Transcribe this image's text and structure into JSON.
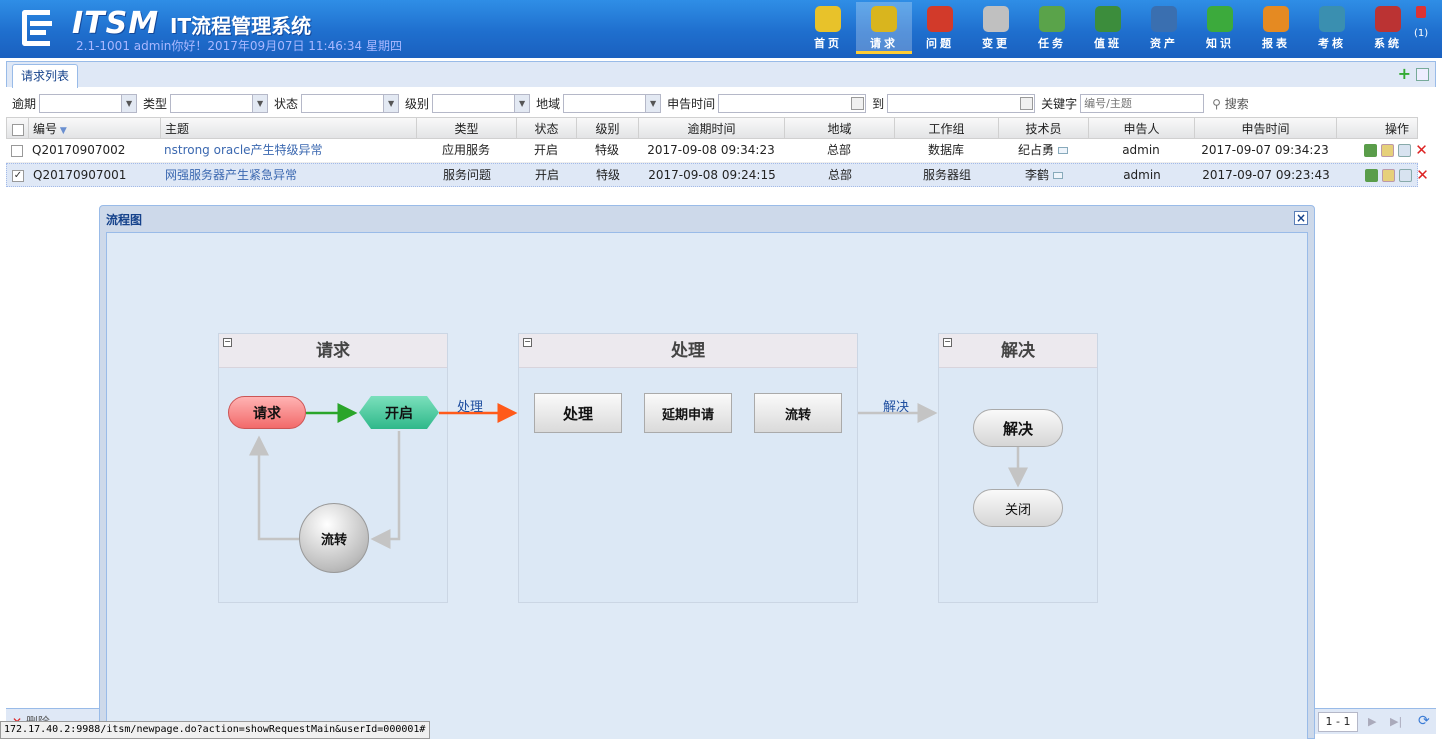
{
  "header": {
    "brand": "ITSM",
    "system_title": "IT流程管理系统",
    "version": "2.1-1001",
    "greeting": "admin你好！2017年09月07日 11:46:34 星期四",
    "nav": [
      {
        "label": "首页",
        "icon": "book-icon",
        "color": "#e8c22a"
      },
      {
        "label": "请求",
        "icon": "warning-shield-icon",
        "color": "#d9b51e"
      },
      {
        "label": "问题",
        "icon": "alarm-icon",
        "color": "#d23a2a"
      },
      {
        "label": "变更",
        "icon": "edit-icon",
        "color": "#c0c0c0"
      },
      {
        "label": "任务",
        "icon": "task-icon",
        "color": "#5aa34a"
      },
      {
        "label": "值班",
        "icon": "person-clock-icon",
        "color": "#3c8d3c"
      },
      {
        "label": "资产",
        "icon": "monitor-icon",
        "color": "#3a6fb0"
      },
      {
        "label": "知识",
        "icon": "help-icon",
        "color": "#3caa3c"
      },
      {
        "label": "报表",
        "icon": "bar-chart-icon",
        "color": "#e58a22"
      },
      {
        "label": "考核",
        "icon": "window-icon",
        "color": "#3a8fb0"
      },
      {
        "label": "系统",
        "icon": "tools-icon",
        "color": "#bb3333"
      }
    ],
    "active_nav": "请求",
    "message_count": "(1)"
  },
  "tabs": {
    "active": "请求列表"
  },
  "filters": {
    "overdue": "逾期",
    "type": "类型",
    "status": "状态",
    "level": "级别",
    "region": "地域",
    "report_time": "申告时间",
    "to": "到",
    "keyword": "关键字",
    "keyword_placeholder": "编号/主题",
    "search": "搜索"
  },
  "grid": {
    "columns": [
      "编号",
      "主题",
      "类型",
      "状态",
      "级别",
      "逾期时间",
      "地域",
      "工作组",
      "技术员",
      "申告人",
      "申告时间",
      "操作"
    ],
    "rows": [
      {
        "checked": false,
        "id": "Q20170907002",
        "subject": "nstrong oracle产生特级异常",
        "type": "应用服务",
        "status": "开启",
        "level": "特级",
        "due": "2017-09-08 09:34:23",
        "region": "总部",
        "group": "数据库",
        "tech": "纪占勇",
        "reporter": "admin",
        "time": "2017-09-07 09:34:23"
      },
      {
        "checked": true,
        "id": "Q20170907001",
        "subject": "网强服务器产生紧急异常",
        "type": "服务问题",
        "status": "开启",
        "level": "特级",
        "due": "2017-09-08 09:24:15",
        "region": "总部",
        "group": "服务器组",
        "tech": "李鹤",
        "reporter": "admin",
        "time": "2017-09-07 09:23:43"
      }
    ]
  },
  "bottom": {
    "delete": "删除",
    "page": "1 - 1"
  },
  "status_url": "172.17.40.2:9988/itsm/newpage.do?action=showRequestMain&userId=000001#",
  "dialog": {
    "title": "流程图",
    "lanes": [
      "请求",
      "处理",
      "解决"
    ],
    "nodes": {
      "request": "请求",
      "open": "开启",
      "flow": "流转",
      "process": "处理",
      "delay": "延期申请",
      "transfer": "流转",
      "resolve": "解决",
      "close": "关闭"
    },
    "edge_labels": {
      "to_process": "处理",
      "to_resolve": "解决"
    }
  }
}
